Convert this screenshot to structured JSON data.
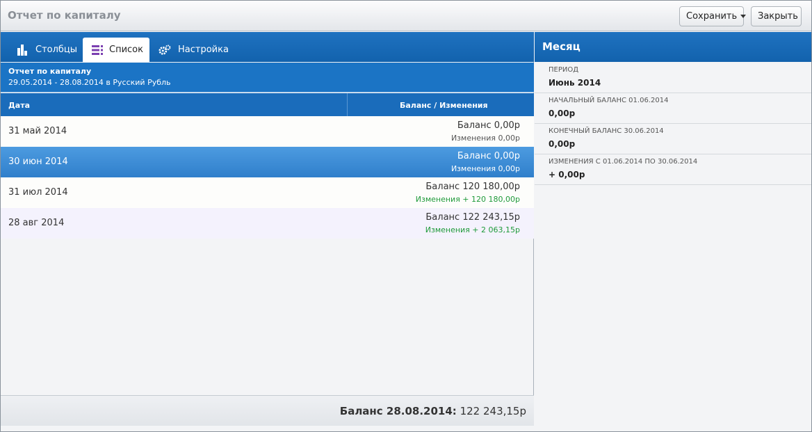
{
  "window": {
    "title": "Отчет по капиталу"
  },
  "toolbar": {
    "save_label": "Сохранить",
    "close_label": "Закрыть"
  },
  "tabs": [
    {
      "label": "Столбцы",
      "icon": "bar-chart-icon"
    },
    {
      "label": "Список",
      "icon": "list-icon",
      "active": true
    },
    {
      "label": "Настройка",
      "icon": "gears-icon"
    }
  ],
  "report": {
    "title": "Отчет по капиталу",
    "range": "29.05.2014 - 28.08.2014 в Русский Рубль",
    "col_date": "Дата",
    "col_balance": "Баланс / Изменения",
    "rows": [
      {
        "date": "31 май 2014",
        "balance": "Баланс 0,00р",
        "change": "Изменения  0,00р"
      },
      {
        "date": "30 июн 2014",
        "balance": "Баланс 0,00р",
        "change": "Изменения  0,00р",
        "selected": true
      },
      {
        "date": "31 июл 2014",
        "balance": "Баланс 120 180,00р",
        "change": "Изменения + 120 180,00р"
      },
      {
        "date": "28 авг 2014",
        "balance": "Баланс 122 243,15р",
        "change": "Изменения + 2 063,15р"
      }
    ],
    "footer_label": "Баланс 28.08.2014:",
    "footer_value": " 122 243,15р"
  },
  "details": {
    "title": "Месяц",
    "fields": [
      {
        "key": "ПЕРИОД",
        "value": "Июнь 2014"
      },
      {
        "key": "НАЧАЛЬНЫЙ БАЛАНС 01.06.2014",
        "value": "0,00р"
      },
      {
        "key": "КОНЕЧНЫЙ БАЛАНС 30.06.2014",
        "value": "0,00р"
      },
      {
        "key": "ИЗМЕНЕНИЯ С 01.06.2014 ПО 30.06.2014",
        "value": "+ 0,00р"
      }
    ]
  },
  "colors": {
    "header_blue": "#1b74c5",
    "selected_row": "#3b8bd6",
    "positive_change": "#1f9a3a",
    "list_icon": "#7b3fb0"
  }
}
